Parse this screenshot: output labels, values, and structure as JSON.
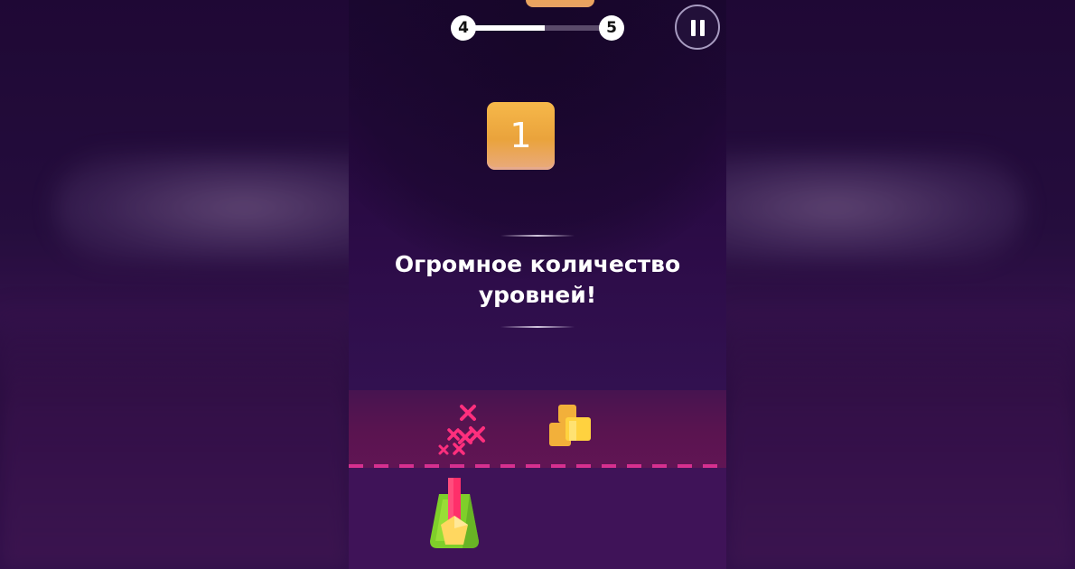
{
  "hud": {
    "current_level": "4",
    "next_level": "5",
    "level_progress": 0.55
  },
  "falling_block": {
    "value": "1"
  },
  "message": {
    "line1": "Огромное количество",
    "line2": "уровней!"
  },
  "icons": {
    "pause": "pause-icon",
    "crosses_bonus": "crosses-bonus-icon",
    "blocks_bonus": "blocks-bonus-icon",
    "cannon": "cannon-icon"
  },
  "colors": {
    "background": "#2e0d4a",
    "block_gold": "#eaa33c",
    "accent_pink": "#ff2f7d",
    "danger_line": "#d6308f",
    "cannon_green": "#7fcf2a",
    "cannon_red": "#ff2f6a",
    "cannon_yellow": "#ffd760"
  }
}
